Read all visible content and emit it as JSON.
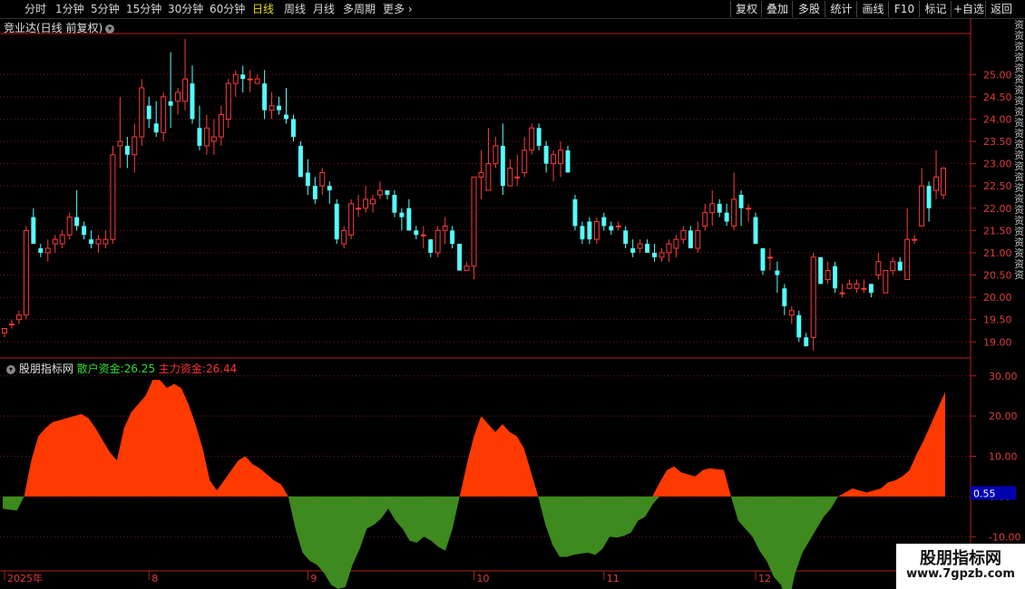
{
  "toolbar": {
    "periods": [
      "分时",
      "1分钟",
      "5分钟",
      "15分钟",
      "30分钟",
      "60分钟",
      "日线",
      "周线",
      "月线",
      "多周期",
      "更多"
    ],
    "active": "日线",
    "buttons": [
      "复权",
      "叠加",
      "多股",
      "统计",
      "画线",
      "F10",
      "标记",
      "+自选",
      "返回"
    ]
  },
  "main_title": "竞业达(日线 前复权)",
  "right_text": "资资资资资资资资资资资资资资资资资资资资资资资资",
  "sub_title": "股朋指标网",
  "legend": {
    "retail_label": "散户资金:",
    "retail_value": "26.25",
    "main_label": "主力资金:",
    "main_value": "26.44"
  },
  "watermark": {
    "line1": "股朋指标网",
    "line2": "www.7gpzb.com"
  },
  "colors": {
    "up": "#ff3b3b",
    "down": "#54ffff",
    "pos_fill": "#ff3a00",
    "neg_fill": "#3e8a1e",
    "axis": "#b22222",
    "grid": "#7a1a1a",
    "label": "#e03c3c",
    "badge": "#0000b0"
  },
  "chart_data": [
    {
      "type": "candlestick",
      "ylim": [
        18.7,
        25.9
      ],
      "yticks": [
        "19.00",
        "19.50",
        "20.00",
        "20.50",
        "21.00",
        "21.50",
        "22.00",
        "22.50",
        "23.00",
        "23.50",
        "24.00",
        "24.50",
        "25.00"
      ],
      "ytick_values": [
        19.0,
        19.5,
        20.0,
        20.5,
        21.0,
        21.5,
        22.0,
        22.5,
        23.0,
        23.5,
        24.0,
        24.5,
        25.0
      ],
      "x_labels": [
        {
          "label": "2025年",
          "index": 0
        },
        {
          "label": "8",
          "index": 20
        },
        {
          "label": "9",
          "index": 42
        },
        {
          "label": "10",
          "index": 65
        },
        {
          "label": "11",
          "index": 83
        },
        {
          "label": "12",
          "index": 104
        }
      ],
      "candles": [
        [
          19.2,
          19.3,
          19.1,
          19.3
        ],
        [
          19.4,
          19.5,
          19.3,
          19.4
        ],
        [
          19.5,
          19.7,
          19.4,
          19.6
        ],
        [
          19.6,
          21.6,
          19.5,
          21.5
        ],
        [
          21.8,
          22.0,
          21.2,
          21.2
        ],
        [
          21.1,
          21.2,
          20.9,
          21.0
        ],
        [
          21.0,
          21.3,
          20.8,
          21.1
        ],
        [
          21.2,
          21.4,
          21.0,
          21.3
        ],
        [
          21.2,
          21.5,
          21.1,
          21.4
        ],
        [
          21.4,
          21.9,
          21.3,
          21.8
        ],
        [
          21.8,
          22.4,
          21.5,
          21.6
        ],
        [
          21.6,
          21.7,
          21.3,
          21.4
        ],
        [
          21.3,
          21.5,
          21.1,
          21.2
        ],
        [
          21.2,
          21.4,
          21.0,
          21.3
        ],
        [
          21.2,
          21.5,
          21.1,
          21.3
        ],
        [
          21.3,
          23.4,
          21.2,
          23.2
        ],
        [
          23.4,
          24.5,
          22.9,
          23.5
        ],
        [
          23.4,
          23.6,
          22.9,
          23.2
        ],
        [
          23.2,
          23.9,
          22.8,
          23.6
        ],
        [
          23.6,
          24.9,
          23.4,
          24.7
        ],
        [
          24.3,
          24.5,
          23.8,
          24.0
        ],
        [
          23.9,
          24.4,
          23.6,
          23.7
        ],
        [
          23.7,
          24.6,
          23.5,
          24.5
        ],
        [
          24.4,
          25.5,
          23.8,
          24.3
        ],
        [
          24.4,
          24.7,
          24.1,
          24.6
        ],
        [
          24.4,
          25.8,
          24.2,
          24.9
        ],
        [
          24.8,
          25.2,
          23.9,
          24.0
        ],
        [
          23.8,
          24.3,
          23.3,
          23.4
        ],
        [
          23.4,
          24.1,
          23.2,
          23.8
        ],
        [
          23.5,
          24.0,
          23.2,
          23.6
        ],
        [
          23.6,
          24.3,
          23.4,
          24.1
        ],
        [
          24.0,
          24.9,
          23.8,
          24.8
        ],
        [
          24.8,
          25.1,
          24.5,
          25.0
        ],
        [
          25.0,
          25.2,
          24.6,
          24.9
        ],
        [
          24.9,
          25.1,
          24.6,
          24.9
        ],
        [
          24.8,
          25.0,
          24.8,
          24.9
        ],
        [
          24.8,
          25.1,
          24.0,
          24.2
        ],
        [
          24.2,
          24.6,
          24.0,
          24.3
        ],
        [
          24.3,
          24.5,
          24.1,
          24.2
        ],
        [
          24.1,
          24.7,
          23.9,
          24.0
        ],
        [
          24.0,
          24.1,
          23.5,
          23.6
        ],
        [
          23.4,
          23.5,
          22.7,
          22.7
        ],
        [
          22.8,
          23.1,
          22.3,
          22.5
        ],
        [
          22.5,
          22.7,
          22.1,
          22.2
        ],
        [
          22.5,
          22.9,
          22.3,
          22.8
        ],
        [
          22.5,
          22.6,
          22.1,
          22.4
        ],
        [
          22.1,
          22.2,
          21.2,
          21.3
        ],
        [
          21.2,
          21.6,
          21.1,
          21.5
        ],
        [
          21.4,
          22.2,
          21.3,
          22.1
        ],
        [
          22.0,
          22.3,
          21.8,
          22.0
        ],
        [
          22.0,
          22.5,
          21.9,
          22.2
        ],
        [
          22.1,
          22.3,
          21.9,
          22.2
        ],
        [
          22.3,
          22.6,
          22.2,
          22.4
        ],
        [
          22.4,
          22.4,
          22.2,
          22.3
        ],
        [
          22.3,
          22.4,
          21.8,
          21.9
        ],
        [
          21.9,
          22.0,
          21.5,
          21.8
        ],
        [
          22.0,
          22.2,
          21.5,
          21.5
        ],
        [
          21.5,
          21.6,
          21.3,
          21.4
        ],
        [
          21.4,
          21.6,
          21.1,
          21.4
        ],
        [
          21.3,
          21.3,
          20.9,
          21.0
        ],
        [
          21.0,
          21.6,
          20.9,
          21.5
        ],
        [
          21.5,
          21.8,
          21.2,
          21.6
        ],
        [
          21.5,
          21.6,
          21.1,
          21.2
        ],
        [
          21.2,
          21.2,
          20.6,
          20.6
        ],
        [
          20.6,
          20.8,
          20.6,
          20.7
        ],
        [
          20.7,
          22.7,
          20.4,
          22.7
        ],
        [
          22.7,
          23.3,
          22.2,
          22.8
        ],
        [
          22.4,
          23.8,
          22.4,
          23.0
        ],
        [
          23.0,
          23.6,
          22.9,
          23.4
        ],
        [
          23.4,
          23.9,
          22.3,
          22.5
        ],
        [
          22.5,
          23.1,
          22.5,
          22.9
        ],
        [
          22.7,
          23.2,
          22.5,
          22.7
        ],
        [
          22.8,
          23.6,
          22.7,
          23.3
        ],
        [
          23.3,
          23.9,
          23.2,
          23.8
        ],
        [
          23.8,
          23.9,
          23.3,
          23.4
        ],
        [
          23.4,
          23.5,
          22.8,
          23.0
        ],
        [
          23.0,
          23.3,
          22.6,
          23.2
        ],
        [
          23.0,
          23.5,
          22.7,
          23.3
        ],
        [
          23.3,
          23.4,
          22.8,
          22.8
        ],
        [
          22.2,
          22.3,
          21.5,
          21.6
        ],
        [
          21.6,
          21.7,
          21.2,
          21.3
        ],
        [
          21.7,
          21.8,
          21.2,
          21.3
        ],
        [
          21.3,
          21.8,
          21.2,
          21.7
        ],
        [
          21.8,
          21.9,
          21.5,
          21.6
        ],
        [
          21.6,
          21.7,
          21.4,
          21.5
        ],
        [
          21.6,
          21.7,
          21.5,
          21.6
        ],
        [
          21.5,
          21.6,
          21.1,
          21.2
        ],
        [
          21.1,
          21.3,
          20.9,
          21.0
        ],
        [
          21.1,
          21.3,
          21.0,
          21.2
        ],
        [
          21.2,
          21.3,
          21.0,
          21.0
        ],
        [
          21.0,
          21.2,
          20.8,
          20.9
        ],
        [
          20.9,
          21.1,
          20.8,
          21.0
        ],
        [
          21.0,
          21.3,
          20.8,
          21.2
        ],
        [
          21.1,
          21.4,
          20.9,
          21.3
        ],
        [
          21.3,
          21.6,
          21.2,
          21.5
        ],
        [
          21.5,
          21.6,
          21.1,
          21.1
        ],
        [
          21.1,
          21.7,
          21.0,
          21.5
        ],
        [
          21.6,
          22.1,
          21.5,
          21.9
        ],
        [
          21.9,
          22.4,
          21.6,
          22.1
        ],
        [
          22.1,
          22.2,
          21.8,
          21.9
        ],
        [
          21.9,
          22.1,
          21.6,
          21.7
        ],
        [
          21.6,
          22.8,
          21.5,
          22.2
        ],
        [
          22.3,
          22.4,
          21.6,
          22.0
        ],
        [
          22.0,
          22.1,
          21.7,
          22.0
        ],
        [
          21.8,
          21.9,
          21.2,
          21.2
        ],
        [
          21.1,
          21.1,
          20.5,
          20.6
        ],
        [
          20.9,
          21.1,
          20.6,
          20.9
        ],
        [
          20.6,
          20.8,
          20.1,
          20.5
        ],
        [
          20.2,
          20.3,
          19.6,
          19.8
        ],
        [
          19.6,
          19.8,
          19.4,
          19.7
        ],
        [
          19.6,
          19.7,
          19.0,
          19.1
        ],
        [
          19.1,
          19.2,
          18.9,
          18.9
        ],
        [
          19.1,
          21.0,
          18.8,
          20.9
        ],
        [
          20.9,
          20.9,
          20.3,
          20.3
        ],
        [
          20.4,
          20.8,
          20.3,
          20.6
        ],
        [
          20.7,
          20.8,
          20.1,
          20.2
        ],
        [
          20.1,
          20.3,
          20.0,
          20.1
        ],
        [
          20.2,
          20.4,
          20.2,
          20.3
        ],
        [
          20.2,
          20.4,
          20.1,
          20.3
        ],
        [
          20.2,
          20.4,
          20.1,
          20.2
        ],
        [
          20.3,
          20.3,
          20.0,
          20.1
        ],
        [
          20.5,
          21.0,
          20.4,
          20.8
        ],
        [
          20.1,
          20.6,
          20.1,
          20.6
        ],
        [
          20.6,
          20.9,
          20.5,
          20.8
        ],
        [
          20.8,
          20.9,
          20.6,
          20.6
        ],
        [
          20.4,
          22.0,
          20.4,
          21.3
        ],
        [
          21.3,
          21.4,
          21.2,
          21.3
        ],
        [
          21.6,
          22.9,
          21.6,
          22.5
        ],
        [
          22.5,
          22.6,
          21.7,
          22.0
        ],
        [
          22.4,
          23.3,
          22.2,
          22.7
        ],
        [
          22.3,
          22.9,
          22.2,
          22.9
        ]
      ]
    },
    {
      "type": "area",
      "ylim": [
        -18.5,
        34
      ],
      "yticks": [
        "-10.00",
        "0.00",
        "10.00",
        "20.00",
        "30.00"
      ],
      "ytick_values": [
        -10,
        0,
        10,
        20,
        30
      ],
      "current_value": "0.55",
      "values": [
        -3,
        -3.3,
        -3.5,
        0,
        9,
        15,
        17,
        18.5,
        19,
        19.5,
        20,
        20.5,
        19.5,
        17,
        14,
        11,
        9,
        17,
        21,
        23,
        25,
        29,
        29,
        27,
        28,
        27,
        23,
        18,
        12,
        4,
        1.5,
        4,
        6.5,
        9,
        10,
        8,
        7,
        5.5,
        4,
        3,
        0,
        -8,
        -14,
        -16,
        -17,
        -19,
        -22,
        -23,
        -22.5,
        -17,
        -13,
        -8,
        -7,
        -5.5,
        -3,
        -6,
        -8,
        -11,
        -11.5,
        -10,
        -11,
        -12.5,
        -13.5,
        -8,
        0,
        8,
        15,
        20,
        18,
        16,
        18,
        16,
        15,
        12,
        6,
        0,
        -7,
        -12,
        -15,
        -15,
        -14.5,
        -14.2,
        -14,
        -14.5,
        -13,
        -10,
        -10.2,
        -9.8,
        -9,
        -6,
        -5,
        -2,
        3.5,
        6.5,
        7.5,
        6,
        5.5,
        5,
        6.5,
        7,
        6.8,
        6.6,
        0,
        -6,
        -8,
        -10,
        -13.5,
        -16,
        -20,
        -22,
        -27,
        -19,
        -14,
        -11,
        -8,
        -5,
        -3,
        0,
        1,
        2,
        1.5,
        1,
        1.5,
        2,
        3.5,
        4,
        5,
        6.5,
        10.5,
        14,
        18,
        22,
        26
      ]
    }
  ]
}
